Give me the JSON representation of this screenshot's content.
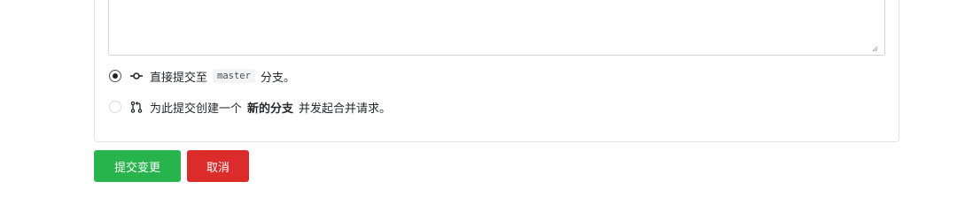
{
  "commit_form": {
    "option_direct": {
      "text_before": "直接提交至",
      "branch": "master",
      "text_after": "分支。",
      "selected": true,
      "icon": "git-commit-icon"
    },
    "option_new_branch": {
      "text_before": "为此提交创建一个",
      "bold": "新的分支",
      "text_after": "并发起合并请求。",
      "selected": false,
      "icon": "git-pull-request-icon"
    },
    "buttons": {
      "commit_label": "提交变更",
      "cancel_label": "取消"
    },
    "colors": {
      "commit": "#28b44d",
      "cancel": "#dc2b2b"
    }
  }
}
